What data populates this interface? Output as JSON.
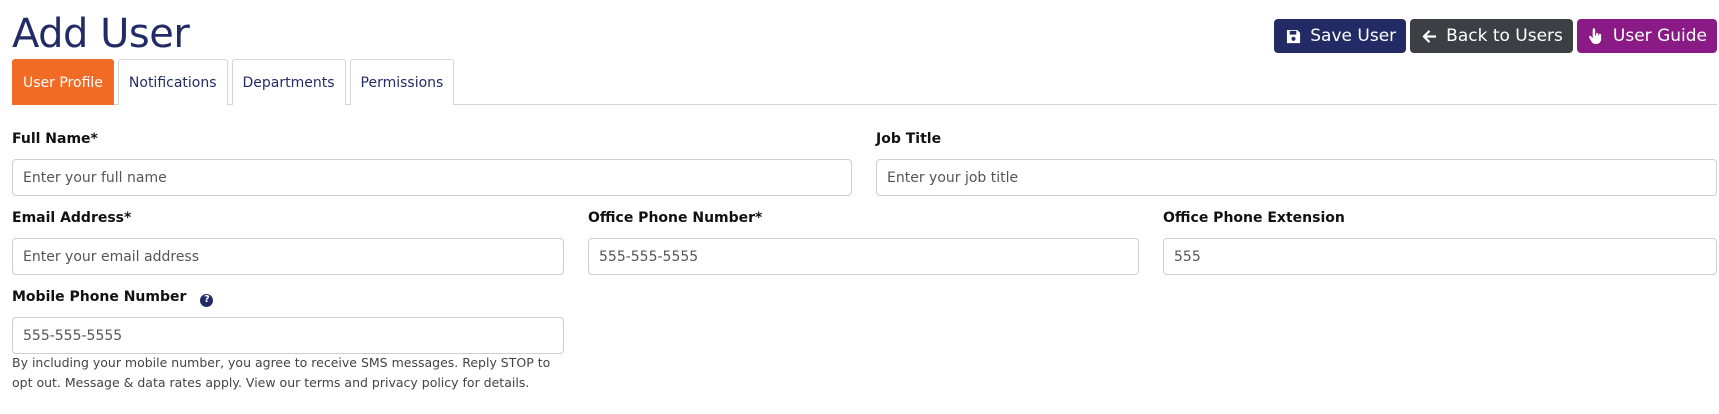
{
  "page": {
    "title": "Add User"
  },
  "actions": {
    "save_label": "Save User",
    "back_label": "Back to Users",
    "guide_label": "User Guide"
  },
  "tabs": [
    {
      "label": "User Profile",
      "active": true
    },
    {
      "label": "Notifications",
      "active": false
    },
    {
      "label": "Departments",
      "active": false
    },
    {
      "label": "Permissions",
      "active": false
    }
  ],
  "form": {
    "full_name": {
      "label": "Full Name*",
      "placeholder": "Enter your full name",
      "value": ""
    },
    "job_title": {
      "label": "Job Title",
      "placeholder": "Enter your job title",
      "value": ""
    },
    "email": {
      "label": "Email Address*",
      "placeholder": "Enter your email address",
      "value": ""
    },
    "office_phone": {
      "label": "Office Phone Number*",
      "placeholder": "555-555-5555",
      "value": ""
    },
    "office_ext": {
      "label": "Office Phone Extension",
      "placeholder": "555",
      "value": ""
    },
    "mobile_phone": {
      "label": "Mobile Phone Number",
      "placeholder": "555-555-5555",
      "value": ""
    },
    "sms_note": "By including your mobile number, you agree to receive SMS messages. Reply STOP to opt out. Message & data rates apply. View our terms and privacy policy for details."
  },
  "icons": {
    "save": "floppy-disk-icon",
    "back": "arrow-left-icon",
    "guide": "hand-pointer-icon",
    "help": "question-circle-icon"
  },
  "colors": {
    "primary": "#232b66",
    "tab_active": "#f26b24",
    "back_button": "#3c3f44",
    "guide_button": "#8a1b86"
  }
}
